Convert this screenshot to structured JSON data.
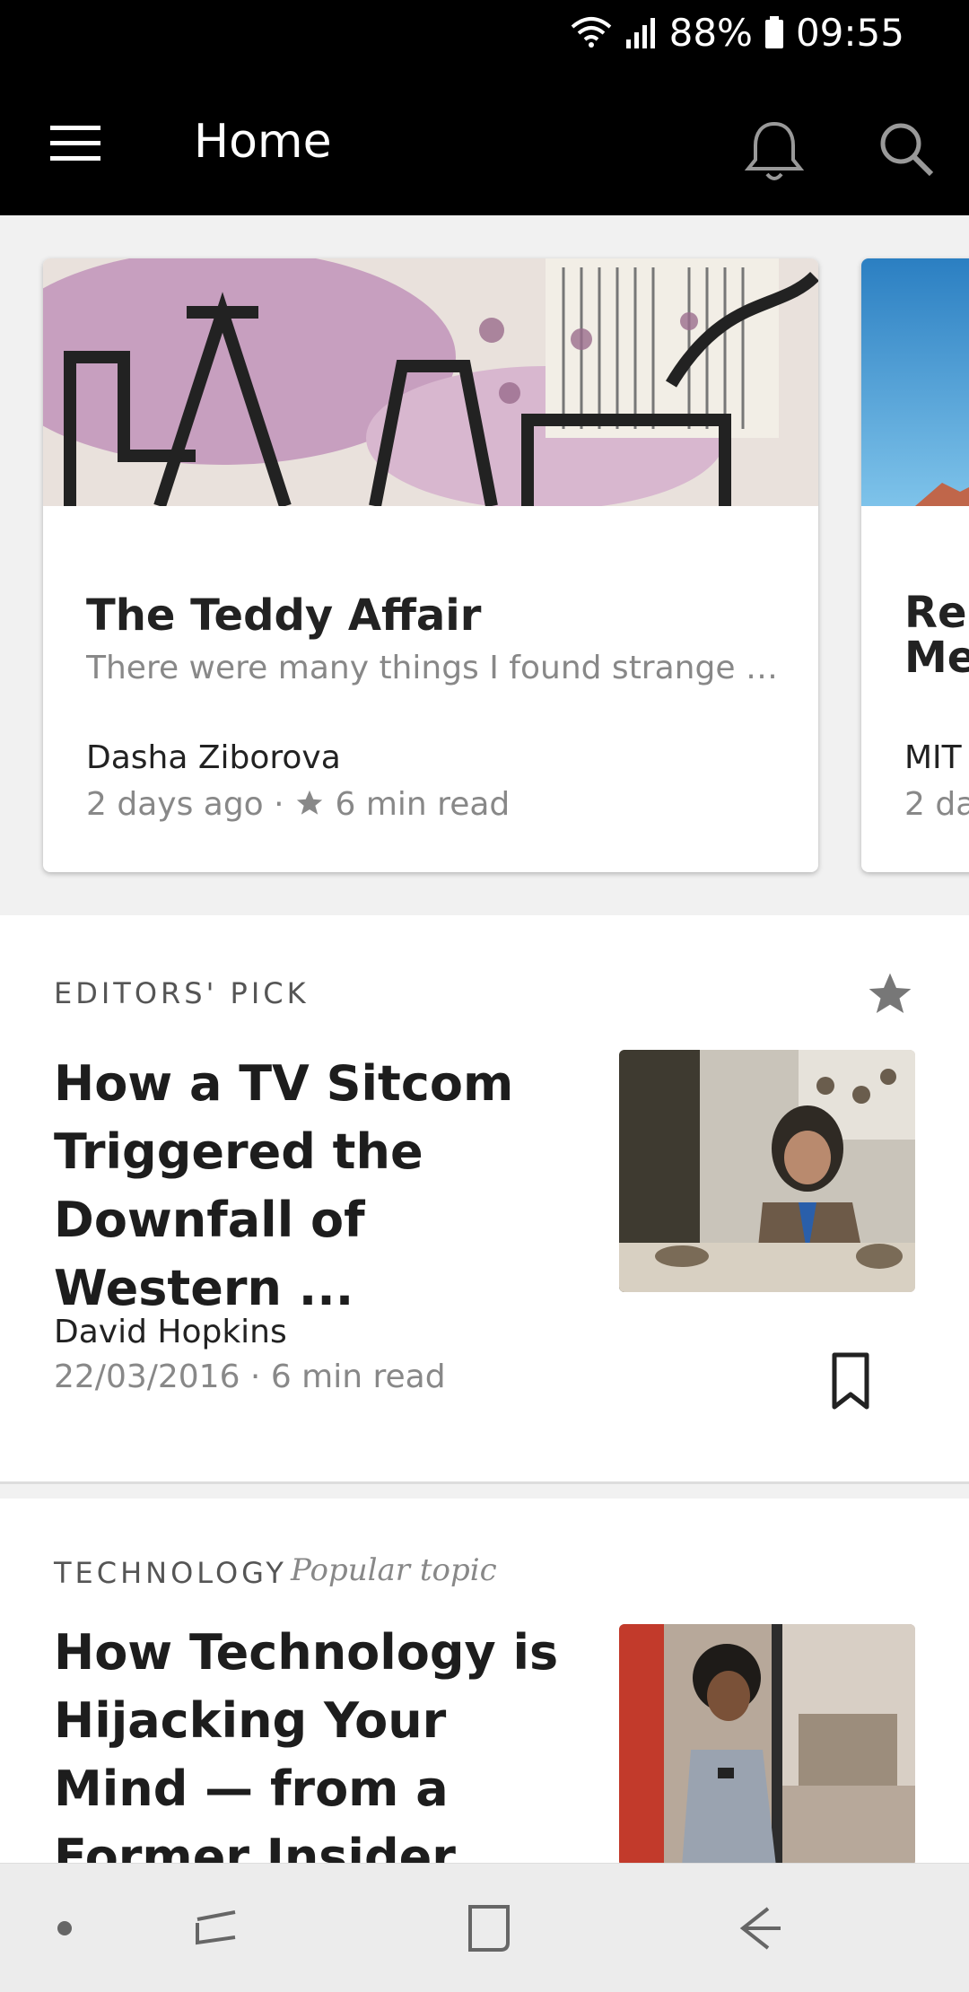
{
  "status": {
    "battery": "88%",
    "time": "09:55"
  },
  "appbar": {
    "title": "Home"
  },
  "featured": [
    {
      "title": "The Teddy Affair",
      "subtitle": "There were many things I found strange wh...",
      "author": "Dasha Ziborova",
      "date": "2 days ago",
      "read": "6 min read"
    },
    {
      "title": "Res\nMe",
      "author": "MIT",
      "date": "2 da"
    }
  ],
  "articles": [
    {
      "kicker": "EDITORS' PICK",
      "title": "How a TV Sitcom Triggered the Downfall of Western ...",
      "author": "David Hopkins",
      "meta": "22/03/2016 · 6 min read"
    },
    {
      "kicker": "TECHNOLOGY",
      "kicker_extra": "Popular topic",
      "title": "How Technology is Hijacking Your Mind — from a Former Insider"
    }
  ],
  "icons": {
    "menu": "hamburger-icon",
    "bell": "bell-icon",
    "search": "search-icon",
    "star": "star-icon",
    "bookmark": "bookmark-icon"
  }
}
